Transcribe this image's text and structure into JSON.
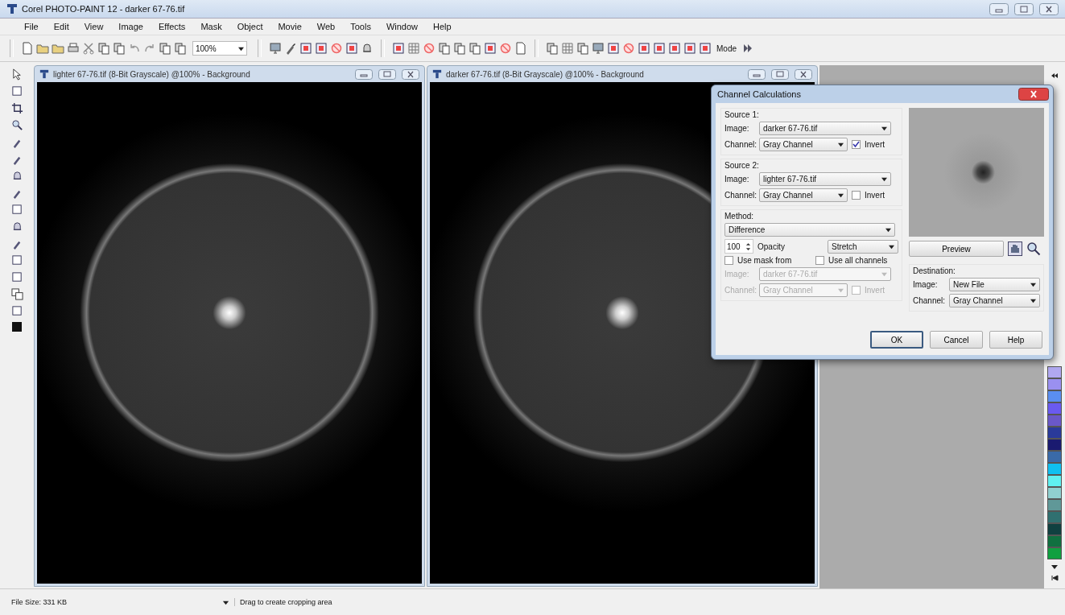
{
  "window": {
    "title": "Corel PHOTO-PAINT 12 - darker 67-76.tif"
  },
  "menu": [
    "File",
    "Edit",
    "View",
    "Image",
    "Effects",
    "Mask",
    "Object",
    "Movie",
    "Web",
    "Tools",
    "Window",
    "Help"
  ],
  "toolbar": {
    "zoom": "100%",
    "mode": "Mode"
  },
  "documents": [
    {
      "title": "lighter 67-76.tif (8-Bit Grayscale) @100% - Background"
    },
    {
      "title": "darker 67-76.tif (8-Bit Grayscale) @100% - Background"
    }
  ],
  "dialog": {
    "title": "Channel Calculations",
    "sources": [
      {
        "heading": "Source 1:",
        "image_label": "Image:",
        "image": "darker 67-76.tif",
        "channel_label": "Channel:",
        "channel": "Gray Channel",
        "invert_label": "Invert",
        "invert": true
      },
      {
        "heading": "Source 2:",
        "image_label": "Image:",
        "image": "lighter 67-76.tif",
        "channel_label": "Channel:",
        "channel": "Gray Channel",
        "invert_label": "Invert",
        "invert": false
      }
    ],
    "method": {
      "heading": "Method:",
      "value": "Difference",
      "opacity": "100",
      "opacity_label": "Opacity",
      "scaling": "Stretch",
      "use_mask_label": "Use mask from",
      "use_mask": false,
      "all_channels_label": "Use all channels",
      "all_channels": false,
      "mask_image_label": "Image:",
      "mask_image": "darker 67-76.tif",
      "mask_channel_label": "Channel:",
      "mask_channel": "Gray Channel",
      "mask_invert_label": "Invert",
      "mask_invert": false,
      "mask_disabled": true
    },
    "preview_button": "Preview",
    "destination": {
      "heading": "Destination:",
      "image_label": "Image:",
      "image": "New File",
      "channel_label": "Channel:",
      "channel": "Gray Channel"
    },
    "buttons": [
      {
        "label": "OK",
        "default": true
      },
      {
        "label": "Cancel",
        "default": false
      },
      {
        "label": "Help",
        "default": false
      }
    ]
  },
  "palette": [
    {
      "color": "#b0a8f0"
    },
    {
      "color": "#9a90f0"
    },
    {
      "color": "#5a8ef0"
    },
    {
      "color": "#6a5af0"
    },
    {
      "color": "#6a58c8"
    },
    {
      "color": "#2a3a9a"
    },
    {
      "color": "#1a1a70"
    },
    {
      "color": "#3a6aa8"
    },
    {
      "color": "#10c0f0"
    },
    {
      "color": "#60f0f0"
    },
    {
      "color": "#90d0d0"
    },
    {
      "color": "#609898"
    },
    {
      "color": "#307070"
    },
    {
      "color": "#104040"
    },
    {
      "color": "#107040"
    },
    {
      "color": "#10a040"
    }
  ],
  "status_bar": {
    "file_size": "File Size: 331 KB",
    "hint": "Drag to create cropping area"
  }
}
